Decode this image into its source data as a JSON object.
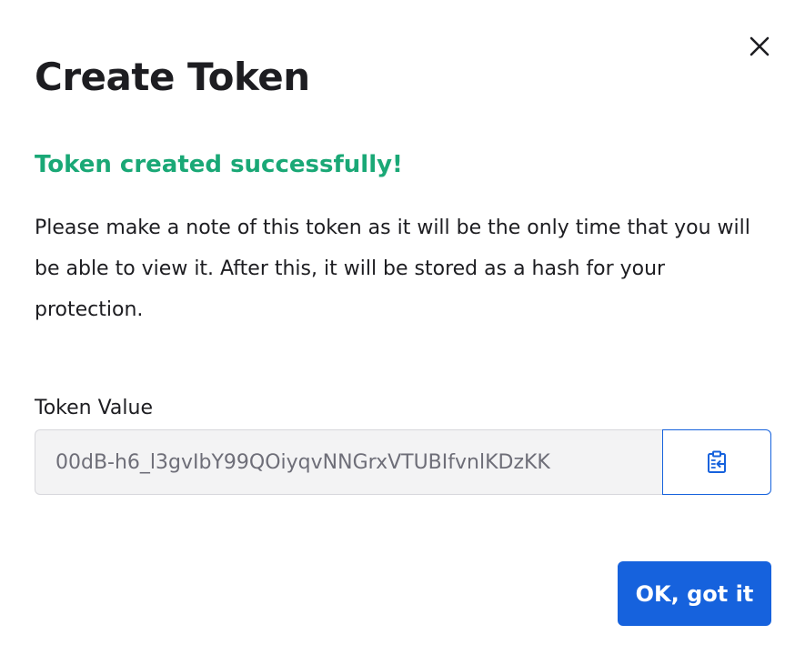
{
  "dialog": {
    "title": "Create Token",
    "success_message": "Token created successfully!",
    "description": "Please make a note of this token as it will be the only time that you will be able to view it. After this, it will be stored as a hash for your protection.",
    "token_label": "Token Value",
    "token_value": "00dB-h6_l3gvIbY99QOiyqvNNGrxVTUBIfvnlKDzKK",
    "ok_button_label": "OK, got it",
    "icons": {
      "close": "close-icon",
      "copy": "copy-to-clipboard-icon"
    },
    "colors": {
      "accent": "#1662dd",
      "success": "#1aa876",
      "input_background": "#f3f3f4"
    }
  }
}
